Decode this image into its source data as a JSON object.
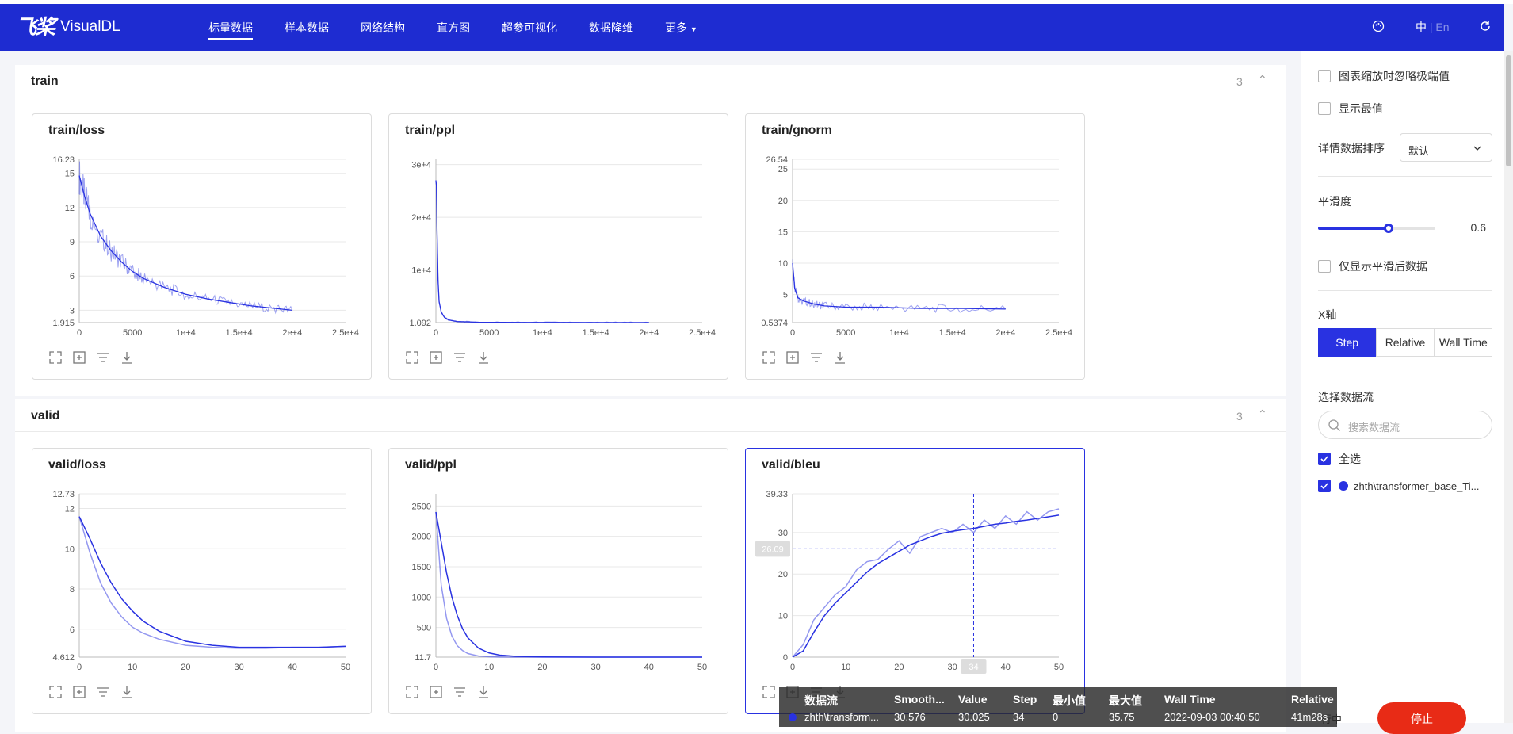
{
  "app": {
    "logo_glyph": "飞桨",
    "name": "VisualDL"
  },
  "nav": {
    "items": [
      "标量数据",
      "样本数据",
      "网络结构",
      "直方图",
      "超参可视化",
      "数据降维",
      "更多"
    ],
    "active_index": 0,
    "lang_cn": "中",
    "lang_sep": "|",
    "lang_en": "En"
  },
  "sections": [
    {
      "title": "train",
      "count": "3",
      "toggle": "⌃"
    },
    {
      "title": "valid",
      "count": "3",
      "toggle": "⌃"
    }
  ],
  "cards": [
    {
      "title": "train/loss",
      "ymax_label": "16.23",
      "ymin_label": "1.915",
      "yticks": [
        "15",
        "12",
        "9",
        "6",
        "3"
      ],
      "xticks": [
        "0",
        "5000",
        "1e+4",
        "1.5e+4",
        "2e+4",
        "2.5e+4"
      ]
    },
    {
      "title": "train/ppl",
      "ymax_label": "",
      "ymin_label": "1.092",
      "yticks": [
        "3e+4",
        "2e+4",
        "1e+4"
      ],
      "xticks": [
        "0",
        "5000",
        "1e+4",
        "1.5e+4",
        "2e+4",
        "2.5e+4"
      ]
    },
    {
      "title": "train/gnorm",
      "ymax_label": "26.54",
      "ymin_label": "0.5374",
      "yticks": [
        "25",
        "20",
        "15",
        "10",
        "5"
      ],
      "xticks": [
        "0",
        "5000",
        "1e+4",
        "1.5e+4",
        "2e+4",
        "2.5e+4"
      ]
    },
    {
      "title": "valid/loss",
      "ymax_label": "12.73",
      "ymin_label": "4.612",
      "yticks": [
        "12",
        "10",
        "8",
        "6"
      ],
      "xticks": [
        "0",
        "10",
        "20",
        "30",
        "40",
        "50"
      ]
    },
    {
      "title": "valid/ppl",
      "ymax_label": "",
      "ymin_label": "11.7",
      "yticks": [
        "2500",
        "2000",
        "1500",
        "1000",
        "500"
      ],
      "xticks": [
        "0",
        "10",
        "20",
        "30",
        "40",
        "50"
      ]
    },
    {
      "title": "valid/bleu",
      "ymax_label": "39.33",
      "ymin_label": "",
      "yticks": [
        "30",
        "20",
        "10",
        "0"
      ],
      "xticks": [
        "0",
        "10",
        "20",
        "30",
        "40",
        "50"
      ],
      "cursor_y_label": "26.09",
      "cursor_x_label": "34"
    }
  ],
  "chart_data": [
    {
      "type": "line",
      "title": "train/loss",
      "xlim": [
        0,
        25000
      ],
      "ylim": [
        1.915,
        16.23
      ],
      "x": [
        0,
        500,
        1000,
        2000,
        3000,
        4000,
        5000,
        6000,
        8000,
        10000,
        12000,
        14000,
        16000,
        18000,
        20000
      ],
      "series": [
        {
          "values": [
            14.8,
            13,
            11.5,
            9.5,
            8.2,
            7.2,
            6.4,
            5.8,
            5.0,
            4.4,
            4.0,
            3.7,
            3.4,
            3.2,
            3.0
          ]
        }
      ]
    },
    {
      "type": "line",
      "title": "train/ppl",
      "xlim": [
        0,
        25000
      ],
      "ylim": [
        1.092,
        31000
      ],
      "x": [
        0,
        50,
        100,
        200,
        300,
        500,
        800,
        1200,
        2000,
        4000,
        8000,
        12000,
        16000,
        20000
      ],
      "series": [
        {
          "values": [
            27000,
            26000,
            18000,
            8000,
            4000,
            2000,
            1000,
            500,
            200,
            80,
            40,
            30,
            25,
            20
          ]
        }
      ]
    },
    {
      "type": "line",
      "title": "train/gnorm",
      "xlim": [
        0,
        25000
      ],
      "ylim": [
        0.5374,
        26.54
      ],
      "x": [
        0,
        200,
        500,
        1000,
        2000,
        3000,
        5000,
        8000,
        12000,
        16000,
        20000
      ],
      "series": [
        {
          "values": [
            10,
            6,
            4.5,
            4,
            3.5,
            3.2,
            3,
            3,
            2.8,
            2.8,
            2.7
          ]
        }
      ]
    },
    {
      "type": "line",
      "title": "valid/loss",
      "xlim": [
        0,
        50
      ],
      "ylim": [
        4.612,
        12.73
      ],
      "x": [
        0,
        2,
        4,
        6,
        8,
        10,
        12,
        15,
        20,
        25,
        30,
        35,
        40,
        45,
        50
      ],
      "series": [
        {
          "values": [
            11.6,
            10.5,
            9.3,
            8.3,
            7.5,
            6.9,
            6.4,
            5.9,
            5.4,
            5.2,
            5.1,
            5.1,
            5.1,
            5.1,
            5.15
          ]
        },
        {
          "values": [
            11.6,
            9.8,
            8.3,
            7.3,
            6.6,
            6.1,
            5.8,
            5.5,
            5.2,
            5.1,
            5.05,
            5.05,
            5.1,
            5.1,
            5.15
          ]
        }
      ]
    },
    {
      "type": "line",
      "title": "valid/ppl",
      "xlim": [
        0,
        50
      ],
      "ylim": [
        11.7,
        2700
      ],
      "x": [
        0,
        1,
        2,
        3,
        4,
        5,
        6,
        8,
        10,
        12,
        15,
        20,
        30,
        40,
        50
      ],
      "series": [
        {
          "values": [
            2400,
            1900,
            1400,
            1000,
            700,
            480,
            330,
            160,
            80,
            45,
            25,
            15,
            12,
            12,
            12
          ]
        },
        {
          "values": [
            2400,
            1200,
            650,
            360,
            200,
            120,
            70,
            30,
            18,
            14,
            12,
            12,
            12,
            12,
            12
          ]
        }
      ]
    },
    {
      "type": "line",
      "title": "valid/bleu",
      "xlim": [
        0,
        50
      ],
      "ylim": [
        0,
        39.33
      ],
      "x": [
        0,
        2,
        4,
        6,
        8,
        10,
        12,
        14,
        16,
        18,
        20,
        22,
        24,
        26,
        28,
        30,
        32,
        34,
        36,
        38,
        40,
        42,
        44,
        46,
        48,
        50
      ],
      "series": [
        {
          "values": [
            0,
            1.5,
            6,
            10,
            13,
            15.5,
            18,
            20.5,
            22.5,
            24,
            25.5,
            27,
            28,
            29,
            29.8,
            30.3,
            30.7,
            31,
            31.5,
            32,
            32.3,
            32.7,
            33,
            33.4,
            33.8,
            34.2
          ]
        },
        {
          "values": [
            0,
            3,
            9,
            12,
            15,
            17,
            21,
            23,
            23.5,
            26,
            28,
            25,
            29,
            30,
            31,
            30,
            32,
            30,
            33,
            31,
            34,
            32,
            35,
            33,
            35,
            35.7
          ]
        }
      ]
    }
  ],
  "sidebar": {
    "ignore_outliers_label": "图表缩放时忽略极端值",
    "show_max_label": "显示最值",
    "sort_label": "详情数据排序",
    "sort_value": "默认",
    "smoothing_label": "平滑度",
    "smoothing_value": "0.6",
    "smoothing_fraction": 0.6,
    "only_smoothed_label": "仅显示平滑后数据",
    "xaxis_label": "X轴",
    "xaxis_options": [
      "Step",
      "Relative",
      "Wall Time"
    ],
    "xaxis_selected": 0,
    "stream_label": "选择数据流",
    "search_placeholder": "搜索数据流",
    "select_all_label": "全选",
    "run_label": "zhth\\transformer_base_Ti..."
  },
  "tooltip": {
    "headers": [
      "数据流",
      "Smooth...",
      "Value",
      "Step",
      "最小值",
      "最大值",
      "Wall Time",
      "Relative"
    ],
    "row": [
      "zhth\\transform...",
      "30.576",
      "30.025",
      "34",
      "0",
      "35.75",
      "2022-09-03 00:40:50",
      "41m28s"
    ]
  },
  "status": {
    "running_text": "行中",
    "stop_button": "停止"
  },
  "colors": {
    "accent": "#2932e1",
    "nav_bg": "#1e2cd1",
    "stop": "#e82b16"
  }
}
